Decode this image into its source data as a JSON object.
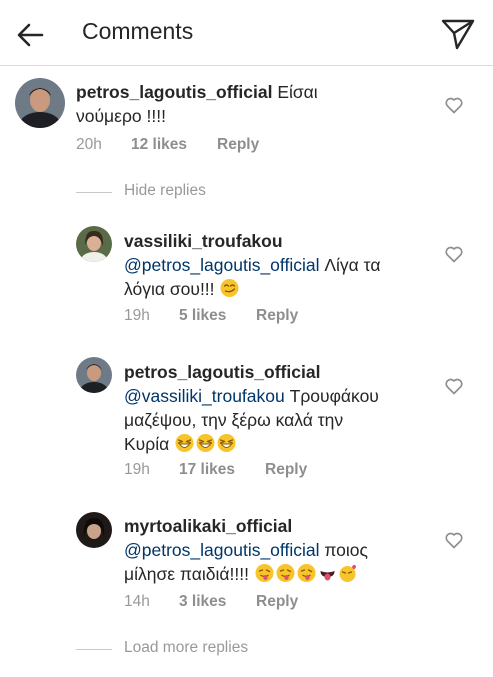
{
  "header": {
    "title": "Comments",
    "back_icon": "arrow-left-icon",
    "share_icon": "paper-plane-icon"
  },
  "comments": [
    {
      "username": "petros_lagoutis_official",
      "text_line1": "Είσαι",
      "text_line2": "νούμερο !!!!",
      "time": "20h",
      "likes": "12 likes",
      "reply": "Reply"
    }
  ],
  "hide_replies": "Hide replies",
  "replies": [
    {
      "username": "vassiliki_troufakou",
      "mention": "@petros_lagoutis_official",
      "text_a": "Λίγα τα",
      "text_b": "λόγια σου!!!",
      "time": "19h",
      "likes": "5 likes",
      "reply": "Reply"
    },
    {
      "username": "petros_lagoutis_official",
      "mention": "@vassiliki_troufakou",
      "text_a": "Τρουφάκου",
      "text_b": "μαζέψου, την ξέρω καλά την",
      "text_c": "Κυρία",
      "time": "19h",
      "likes": "17 likes",
      "reply": "Reply"
    },
    {
      "username": "myrtoalikaki_official",
      "mention": "@petros_lagoutis_official",
      "text_a": "ποιος",
      "text_b": "μίλησε παιδιά!!!!",
      "time": "14h",
      "likes": "3 likes",
      "reply": "Reply"
    }
  ],
  "load_more": "Load more replies",
  "colors": {
    "mention": "#003569",
    "meta": "#999999",
    "emoji": "#f7c52b"
  }
}
